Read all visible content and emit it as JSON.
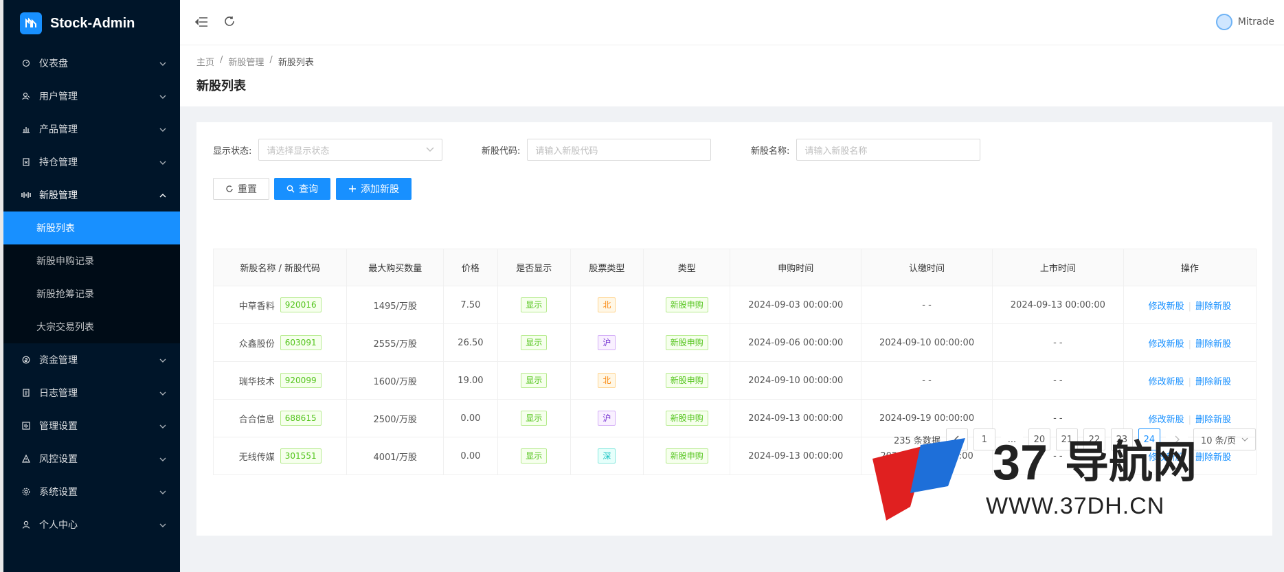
{
  "app": {
    "title": "Stock-Admin"
  },
  "header": {
    "user_name": "Mitrade"
  },
  "sidebar": {
    "items": [
      {
        "label": "仪表盘",
        "icon": "dashboard-icon"
      },
      {
        "label": "用户管理",
        "icon": "users-icon"
      },
      {
        "label": "产品管理",
        "icon": "chart-icon"
      },
      {
        "label": "持仓管理",
        "icon": "position-icon"
      },
      {
        "label": "新股管理",
        "icon": "ipo-icon",
        "open": true,
        "children": [
          "新股列表",
          "新股申购记录",
          "新股抢筹记录",
          "大宗交易列表"
        ]
      },
      {
        "label": "资金管理",
        "icon": "money-icon"
      },
      {
        "label": "日志管理",
        "icon": "log-icon"
      },
      {
        "label": "管理设置",
        "icon": "admin-icon"
      },
      {
        "label": "风控设置",
        "icon": "warning-icon"
      },
      {
        "label": "系统设置",
        "icon": "settings-icon"
      },
      {
        "label": "个人中心",
        "icon": "profile-icon"
      }
    ]
  },
  "breadcrumb": {
    "home": "主页",
    "parent": "新股管理",
    "current": "新股列表",
    "sep": "/"
  },
  "page": {
    "title": "新股列表"
  },
  "filters": {
    "status_label": "显示状态:",
    "status_placeholder": "请选择显示状态",
    "code_label": "新股代码:",
    "code_placeholder": "请输入新股代码",
    "name_label": "新股名称:",
    "name_placeholder": "请输入新股名称"
  },
  "buttons": {
    "reset": "重置",
    "query": "查询",
    "add": "添加新股"
  },
  "table": {
    "headers": [
      "新股名称 / 新股代码",
      "最大购买数量",
      "价格",
      "是否显示",
      "股票类型",
      "类型",
      "申购时间",
      "认缴时间",
      "上市时间",
      "操作"
    ],
    "rows": [
      {
        "name": "中草香料",
        "code": "920016",
        "qty": "1495/万股",
        "price": "7.50",
        "show": "显示",
        "market": "北",
        "market_color": "orange",
        "type": "新股申购",
        "sub_time": "2024-09-03 00:00:00",
        "pay_time": "- -",
        "list_time": "2024-09-13 00:00:00",
        "edit": "修改新股",
        "del": "删除新股"
      },
      {
        "name": "众鑫股份",
        "code": "603091",
        "qty": "2555/万股",
        "price": "26.50",
        "show": "显示",
        "market": "沪",
        "market_color": "purple",
        "type": "新股申购",
        "sub_time": "2024-09-06 00:00:00",
        "pay_time": "2024-09-10 00:00:00",
        "list_time": "- -",
        "edit": "修改新股",
        "del": "删除新股"
      },
      {
        "name": "瑞华技术",
        "code": "920099",
        "qty": "1600/万股",
        "price": "19.00",
        "show": "显示",
        "market": "北",
        "market_color": "orange",
        "type": "新股申购",
        "sub_time": "2024-09-10 00:00:00",
        "pay_time": "- -",
        "list_time": "- -",
        "edit": "修改新股",
        "del": "删除新股"
      },
      {
        "name": "合合信息",
        "code": "688615",
        "qty": "2500/万股",
        "price": "0.00",
        "show": "显示",
        "market": "沪",
        "market_color": "purple",
        "type": "新股申购",
        "sub_time": "2024-09-13 00:00:00",
        "pay_time": "2024-09-19 00:00:00",
        "list_time": "- -",
        "edit": "修改新股",
        "del": "删除新股"
      },
      {
        "name": "无线传媒",
        "code": "301551",
        "qty": "4001/万股",
        "price": "0.00",
        "show": "显示",
        "market": "深",
        "market_color": "cyan",
        "type": "新股申购",
        "sub_time": "2024-09-13 00:00:00",
        "pay_time": "2024-09-?? 00:00:00",
        "list_time": "- -",
        "edit": "修改新股",
        "del": "删除新股"
      }
    ]
  },
  "pagination": {
    "total": "235 条数据",
    "pages": [
      "1",
      "...",
      "20",
      "21",
      "22",
      "23",
      "24"
    ],
    "current": "24",
    "page_size": "10 条/页"
  },
  "watermark": {
    "number": "37",
    "cn": "导航网",
    "url": "WWW.37DH.CN"
  },
  "colors": {
    "sidebar_bg": "#001529",
    "accent": "#1890ff"
  }
}
